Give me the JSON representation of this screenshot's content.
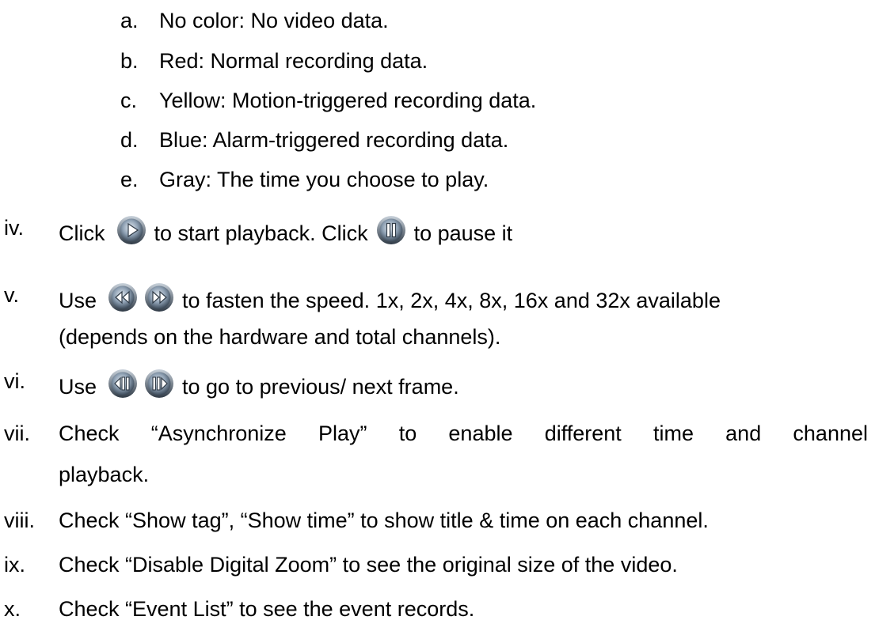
{
  "sublist": [
    {
      "marker": "a.",
      "text": "No color: No video data."
    },
    {
      "marker": "b.",
      "text": "Red: Normal recording data."
    },
    {
      "marker": "c.",
      "text": "Yellow: Motion-triggered recording data."
    },
    {
      "marker": "d.",
      "text": "Blue: Alarm-triggered recording data."
    },
    {
      "marker": "e.",
      "text": "Gray: The time you choose to play."
    }
  ],
  "items": {
    "iv": {
      "marker": "iv.",
      "part1": "Click",
      "part2": "to start playback. Click",
      "part3": "to pause it",
      "icons": [
        "play-icon",
        "pause-icon"
      ]
    },
    "v": {
      "marker": "v.",
      "part1": "Use",
      "part2": "to fasten the speed. 1x, 2x, 4x, 8x, 16x and 32x available",
      "cont": "(depends on the hardware and total channels).",
      "icons": [
        "rewind-icon",
        "fast-forward-icon"
      ]
    },
    "vi": {
      "marker": "vi.",
      "part1": "Use",
      "part2": "to go to previous/ next frame.",
      "icons": [
        "previous-frame-icon",
        "next-frame-icon"
      ]
    },
    "vii": {
      "marker": "vii.",
      "words": [
        "Check",
        "“Asynchronize",
        "Play”",
        "to",
        "enable",
        "different",
        "time",
        "and",
        "channel"
      ],
      "cont": "playback."
    },
    "viii": {
      "marker": "viii.",
      "text": "Check “Show tag”, “Show time” to show title & time on each channel."
    },
    "ix": {
      "marker": "ix.",
      "text": "Check “Disable Digital Zoom” to see the original size of the video."
    },
    "x": {
      "marker": "x.",
      "text": "Check “Event List” to see the event records."
    }
  },
  "colors": {
    "text": "#000000",
    "background": "#ffffff",
    "icon_ring": "#5b6b7c",
    "icon_face": "#9aa9b8",
    "icon_glyph": "#ffffff"
  }
}
